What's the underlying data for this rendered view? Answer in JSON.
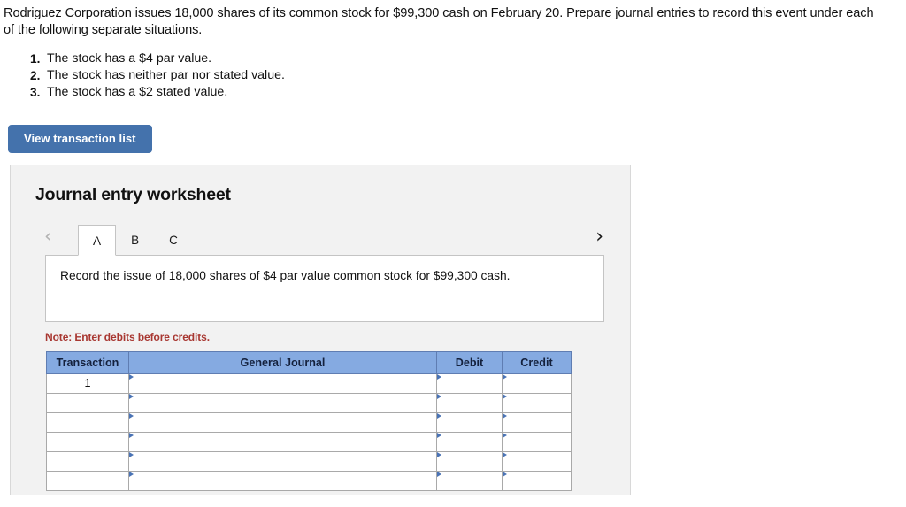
{
  "problem": {
    "statement": "Rodriguez Corporation issues 18,000 shares of its common stock for $99,300 cash on February 20. Prepare journal entries to record this event under each of the following separate situations.",
    "situations": [
      "The stock has a $4 par value.",
      "The stock has neither par nor stated value.",
      "The stock has a $2 stated value."
    ]
  },
  "toolbar": {
    "view_transaction_list_label": "View transaction list"
  },
  "worksheet": {
    "title": "Journal entry worksheet",
    "prev_icon": "chevron-left-icon",
    "next_icon": "chevron-right-icon",
    "prev_glyph": "‹",
    "next_glyph": "›",
    "tabs": [
      {
        "label": "A",
        "active": true
      },
      {
        "label": "B",
        "active": false
      },
      {
        "label": "C",
        "active": false
      }
    ],
    "instruction": "Record the issue of 18,000 shares of $4 par value common stock for $99,300 cash.",
    "note": "Note: Enter debits before credits."
  },
  "journal_table": {
    "columns": [
      "Transaction",
      "General Journal",
      "Debit",
      "Credit"
    ],
    "rows": [
      {
        "transaction": "1",
        "general_journal": "",
        "debit": "",
        "credit": ""
      },
      {
        "transaction": "",
        "general_journal": "",
        "debit": "",
        "credit": ""
      },
      {
        "transaction": "",
        "general_journal": "",
        "debit": "",
        "credit": ""
      },
      {
        "transaction": "",
        "general_journal": "",
        "debit": "",
        "credit": ""
      },
      {
        "transaction": "",
        "general_journal": "",
        "debit": "",
        "credit": ""
      },
      {
        "transaction": "",
        "general_journal": "",
        "debit": "",
        "credit": ""
      }
    ]
  },
  "colors": {
    "button_blue": "#4472ac",
    "header_blue": "#85aae1",
    "cell_border_blue": "#6080b8",
    "note_red": "#a83731",
    "panel_gray": "#f2f2f2"
  }
}
